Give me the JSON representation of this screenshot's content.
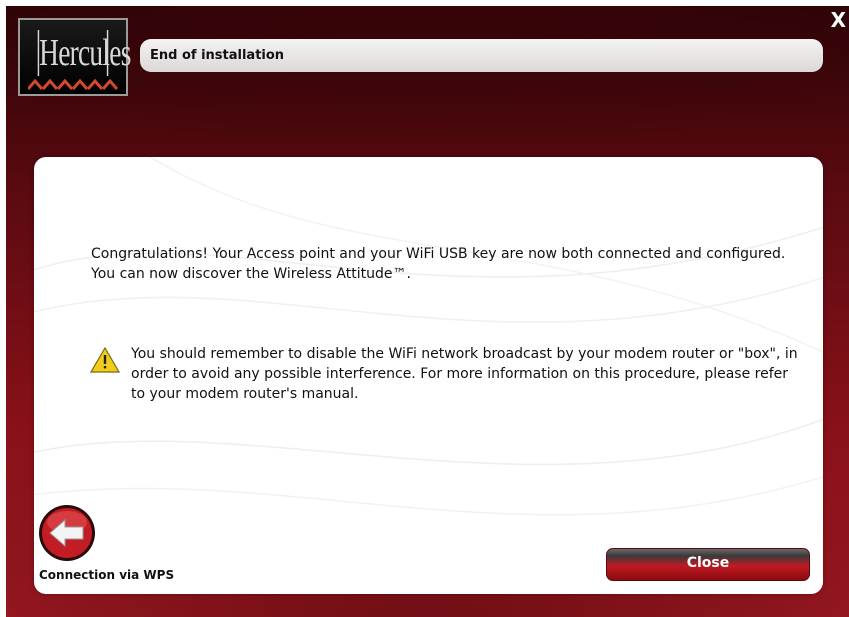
{
  "window": {
    "title": "End of installation",
    "close_glyph": "X",
    "logo_text": "Hercules"
  },
  "content": {
    "message": "Congratulations! Your Access point and your WiFi USB key are now both connected and configured. You can now discover the Wireless Attitude™.",
    "warning": "You should remember to disable the WiFi network broadcast by your modem router or \"box\", in order to avoid any possible interference. For more information on this procedure, please refer to your modem router's manual."
  },
  "footer": {
    "back_label": "Connection via WPS",
    "close_label": "Close"
  },
  "icons": {
    "warning": "warning-triangle-icon",
    "back": "back-arrow-icon",
    "logo": "hercules-logo"
  },
  "colors": {
    "accent": "#b01620",
    "background_dark": "#2a0306",
    "warning_yellow": "#f2cc1a"
  }
}
